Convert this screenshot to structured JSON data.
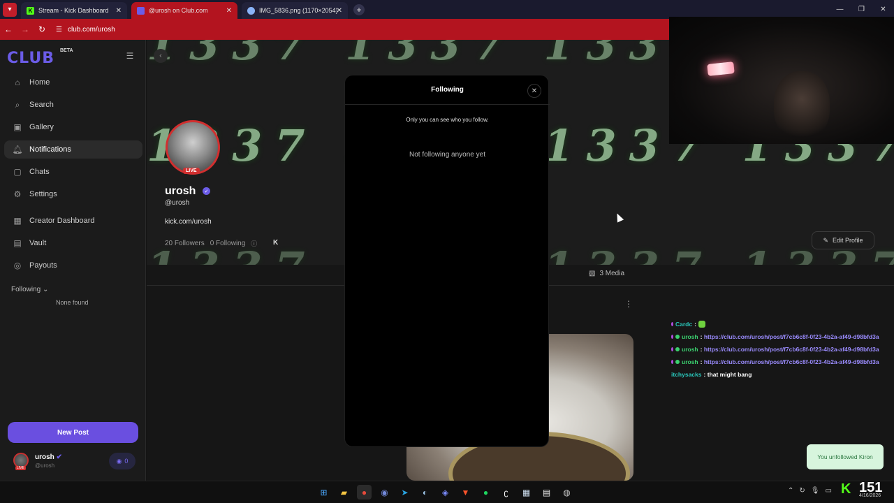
{
  "browser": {
    "tabs": [
      {
        "label": "Stream - Kick Dashboard",
        "icon": "kick-icon",
        "color": "#53fc18"
      },
      {
        "label": "@urosh on Club.com",
        "icon": "club-icon",
        "color": "#6b5ce7"
      },
      {
        "label": "IMG_5836.png (1170×2054)",
        "icon": "globe-icon",
        "color": "#8ab4f8"
      }
    ],
    "url": "club.com/urosh"
  },
  "sidebar": {
    "logo": "CLUB",
    "beta": "BETA",
    "items": [
      {
        "label": "Home",
        "icon": "home-icon"
      },
      {
        "label": "Search",
        "icon": "search-icon"
      },
      {
        "label": "Gallery",
        "icon": "gallery-icon"
      },
      {
        "label": "Notifications",
        "icon": "bell-icon",
        "active": true
      },
      {
        "label": "Chats",
        "icon": "chat-icon"
      },
      {
        "label": "Settings",
        "icon": "gear-icon"
      },
      {
        "label": "Creator Dashboard",
        "icon": "dashboard-icon"
      },
      {
        "label": "Vault",
        "icon": "vault-icon"
      },
      {
        "label": "Payouts",
        "icon": "payouts-icon"
      }
    ],
    "following_heading": "Following",
    "none_found": "None found",
    "new_post": "New Post",
    "user": {
      "name": "urosh",
      "handle": "@urosh",
      "live": "LIVE",
      "coins": "0"
    }
  },
  "profile": {
    "banner_text": "1337",
    "live": "LIVE",
    "name": "urosh",
    "handle": "@urosh",
    "link": "kick.com/urosh",
    "followers": "20 Followers",
    "following": "0 Following",
    "edit_profile": "Edit Profile",
    "media_tab": "3 Media"
  },
  "modal": {
    "title": "Following",
    "note": "Only you can see who you follow.",
    "empty": "Not following anyone yet"
  },
  "chat": [
    {
      "user": "Cardc",
      "message": "",
      "emote": true
    },
    {
      "user": "urosh",
      "link": "https://club.com/urosh/post/f7cb6c8f-0f23-4b2a-af49-d98bfd3a"
    },
    {
      "user": "urosh",
      "link": "https://club.com/urosh/post/f7cb6c8f-0f23-4b2a-af49-d98bfd3a"
    },
    {
      "user": "urosh",
      "link": "https://club.com/urosh/post/f7cb6c8f-0f23-4b2a-af49-d98bfd3a"
    },
    {
      "user": "itchysacks",
      "message": "that might bang"
    }
  ],
  "toast": "You unfollowed Kiron",
  "taskbar": {
    "viewer_count": "151",
    "date": "4/16/2026"
  },
  "colors": {
    "accent": "#6b5ce7",
    "live": "#d12f2f",
    "kick": "#53fc18",
    "browser_red": "#b3141f"
  }
}
